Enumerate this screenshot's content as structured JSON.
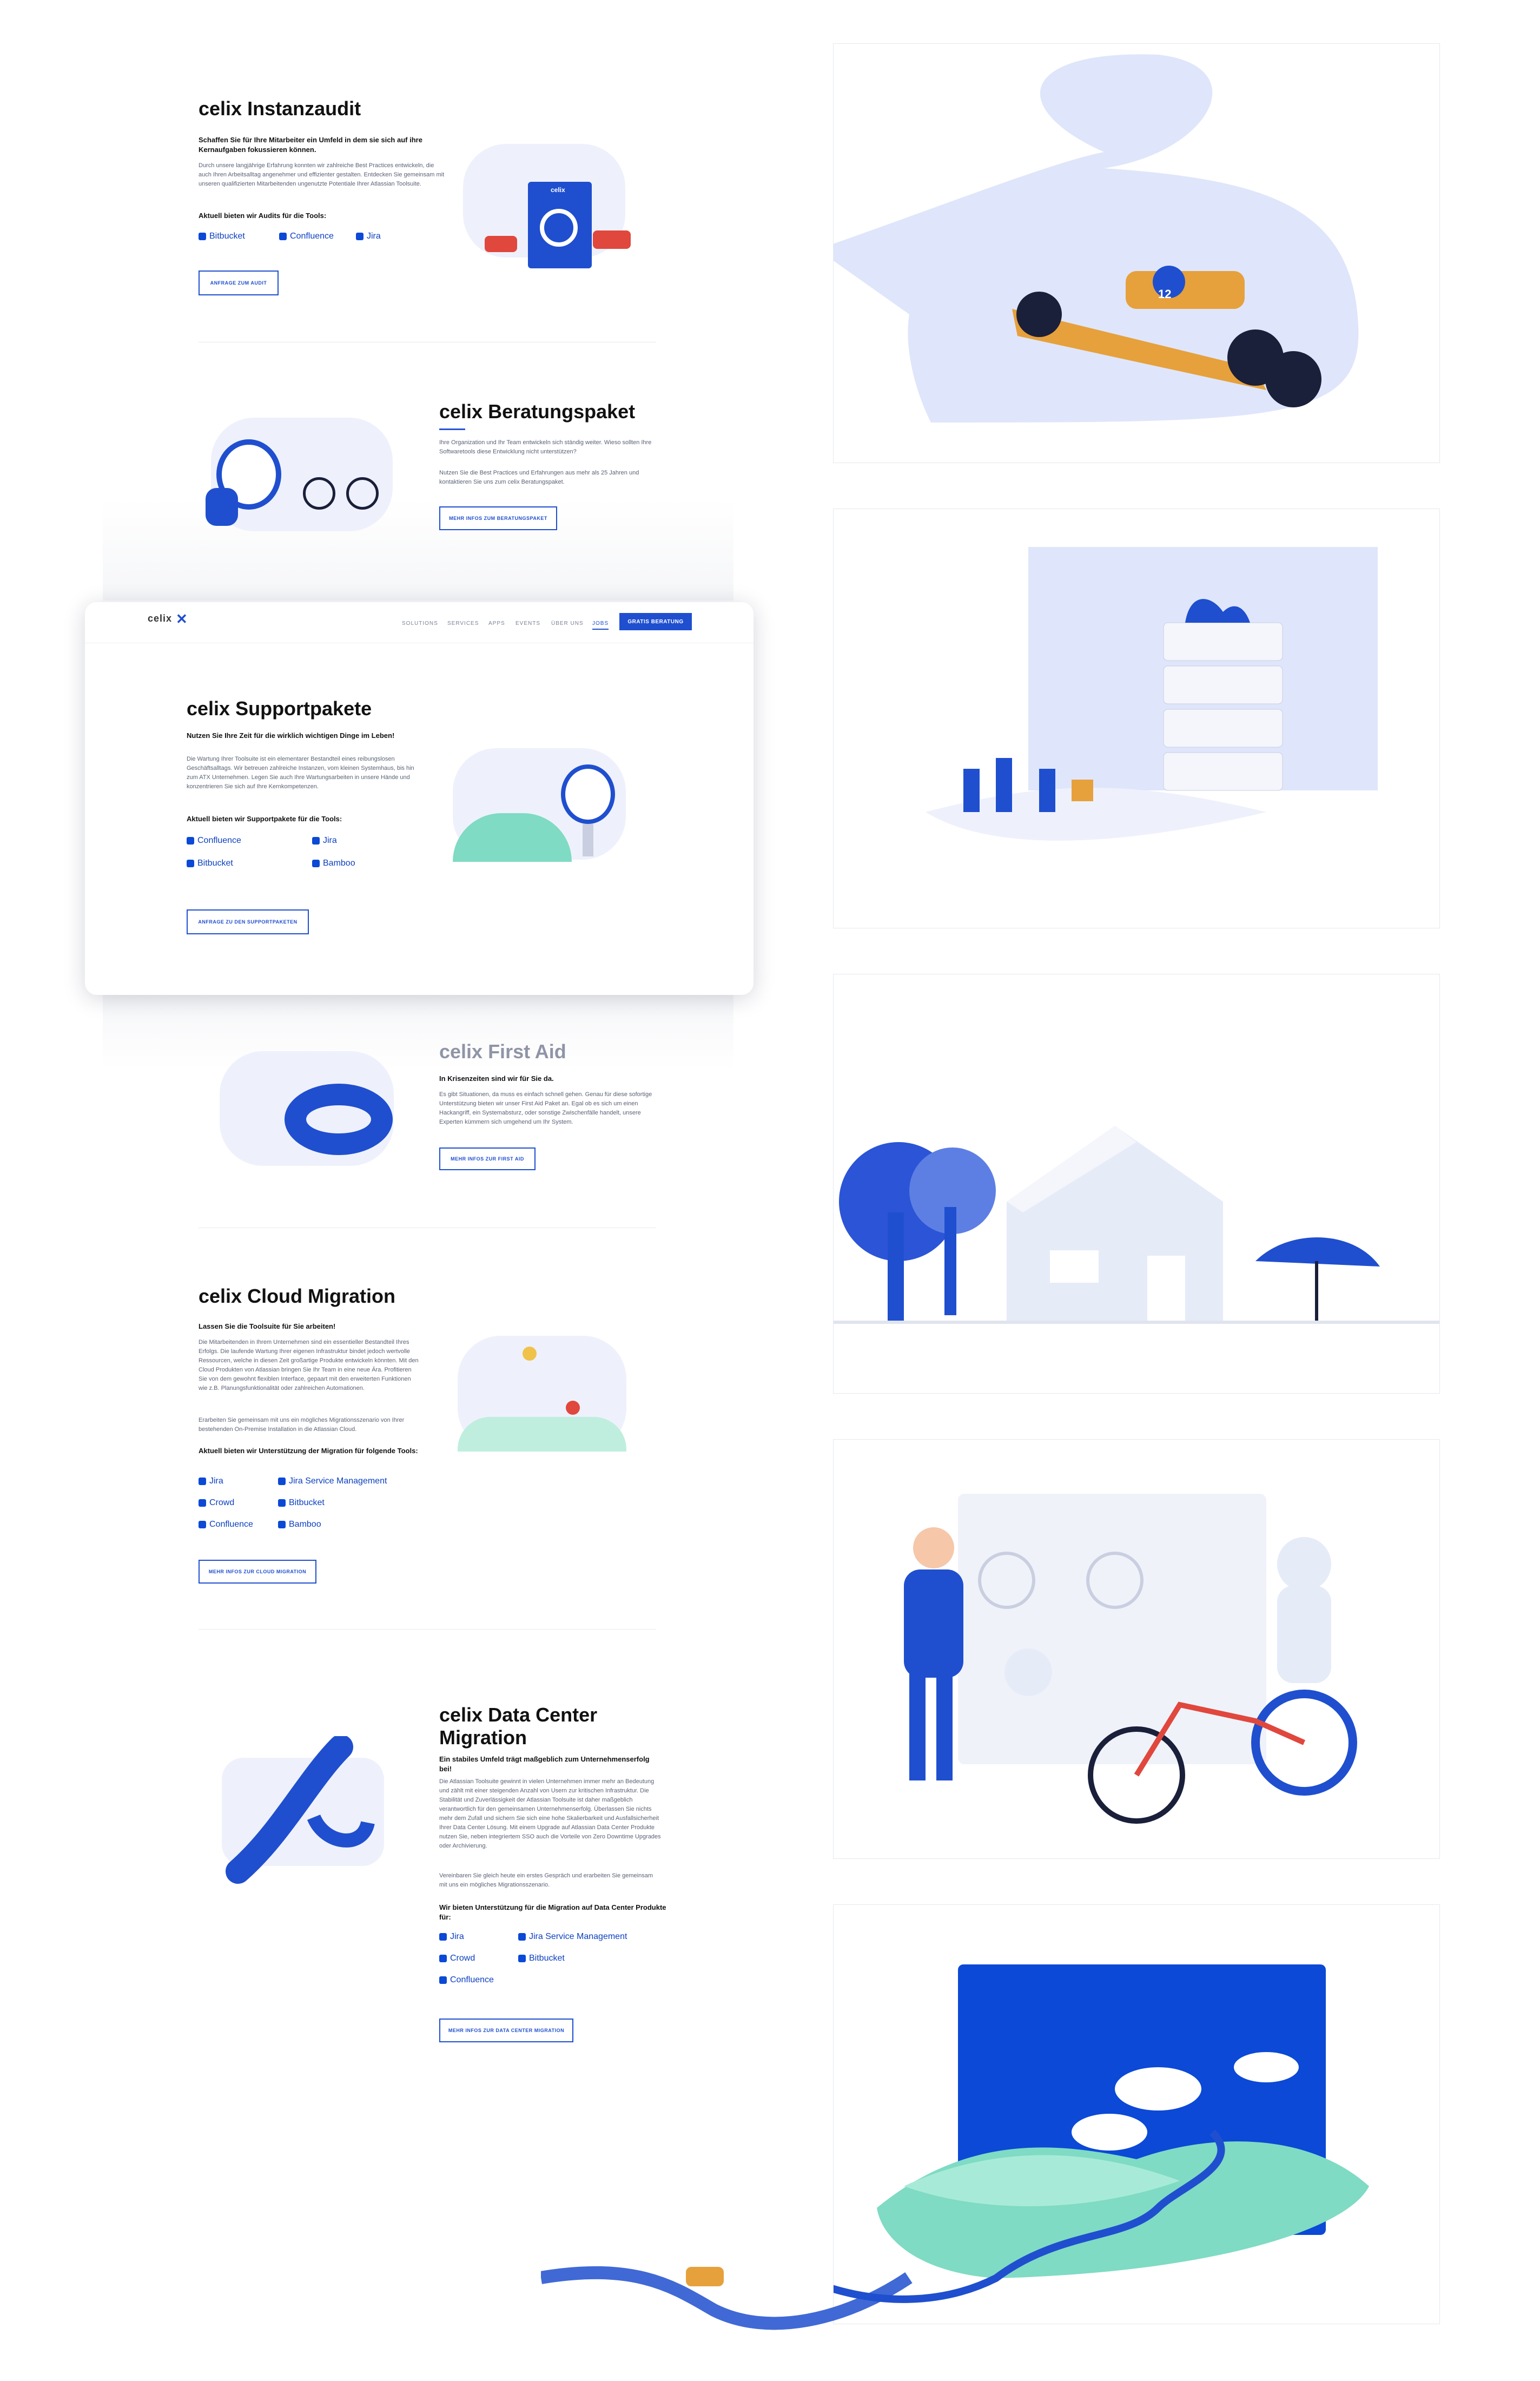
{
  "sections": {
    "instanzaudit": {
      "title": "celix Instanzaudit",
      "lead": "Schaffen Sie für Ihre Mitarbeiter ein Umfeld in dem sie sich auf ihre Kernaufgaben fokussieren können.",
      "body": "Durch unsere langjährige Erfahrung konnten wir zahlreiche Best Practices entwickeln, die auch Ihren Arbeitsalltag angenehmer und effizienter gestalten. Entdecken Sie gemeinsam mit unseren qualifizierten Mitarbeitenden ungenutzte Potentiale Ihrer Atlassian Toolsuite.",
      "tools_heading": "Aktuell bieten wir Audits für die Tools:",
      "tools": [
        "Bitbucket",
        "Confluence",
        "Jira"
      ],
      "cta": "ANFRAGE ZUM AUDIT"
    },
    "beratungspaket": {
      "title": "celix Beratungspaket",
      "body1": "Ihre Organization und Ihr Team entwickeln sich ständig weiter. Wieso sollten Ihre Softwaretools diese Entwicklung nicht unterstützen?",
      "body2": "Nutzen Sie die Best Practices und Erfahrungen aus mehr als 25 Jahren und kontaktieren Sie uns zum celix Beratungspaket.",
      "cta": "MEHR INFOS ZUM BERATUNGSPAKET"
    },
    "supportpakete": {
      "title": "celix Supportpakete",
      "lead": "Nutzen Sie Ihre Zeit für die wirklich wichtigen Dinge im Leben!",
      "body": "Die Wartung Ihrer Toolsuite ist ein elementarer Bestandteil eines reibungslosen Geschäftsalltags. Wir betreuen zahlreiche Instanzen, vom kleinen Systemhaus, bis hin zum ATX Unternehmen. Legen Sie auch Ihre Wartungsarbeiten in unsere Hände und konzentrieren Sie sich auf Ihre Kernkompetenzen.",
      "tools_heading": "Aktuell bieten wir Supportpakete für die Tools:",
      "tools": [
        "Confluence",
        "Jira",
        "Bitbucket",
        "Bamboo"
      ],
      "cta": "ANFRAGE ZU DEN SUPPORTPAKETEN"
    },
    "first_aid": {
      "title": "celix First Aid",
      "lead": "In Krisenzeiten sind wir für Sie da.",
      "body": "Es gibt Situationen, da muss es einfach schnell gehen. Genau für diese sofortige Unterstützung bieten wir unser First Aid Paket an. Egal ob es sich um einen Hackangriff, ein Systemabsturz, oder sonstige Zwischenfälle handelt, unsere Experten kümmern sich umgehend um Ihr System.",
      "cta": "MEHR INFOS ZUR FIRST AID"
    },
    "cloud_migration": {
      "title": "celix Cloud Migration",
      "lead": "Lassen Sie die Toolsuite für Sie arbeiten!",
      "body1": "Die Mitarbeitenden in Ihrem Unternehmen sind ein essentieller Bestandteil Ihres Erfolgs. Die laufende Wartung Ihrer eigenen Infrastruktur bindet jedoch wertvolle Ressourcen, welche in diesen Zeit großartige Produkte entwickeln könnten. Mit den Cloud Produkten von Atlassian bringen Sie Ihr Team in eine neue Ära. Profitieren Sie von dem gewohnt flexiblen Interface, gepaart mit den erweiterten Funktionen wie z.B. Planungsfunktionalität oder zahlreichen Automationen.",
      "body2": "Erarbeiten Sie gemeinsam mit uns ein mögliches Migrationsszenario von Ihrer bestehenden On-Premise Installation in die Atlassian Cloud.",
      "tools_heading": "Aktuell bieten wir Unterstützung der Migration für folgende Tools:",
      "tools": [
        "Jira",
        "Jira Service Management",
        "Crowd",
        "Bitbucket",
        "Confluence",
        "Bamboo"
      ],
      "cta": "MEHR INFOS ZUR CLOUD MIGRATION"
    },
    "data_center": {
      "title": "celix Data Center Migration",
      "lead": "Ein stabiles Umfeld trägt maßgeblich zum Unternehmenserfolg bei!",
      "body1": "Die Atlassian Toolsuite gewinnt in vielen Unternehmen immer mehr an Bedeutung und zählt mit einer steigenden Anzahl von Usern zur kritischen Infrastruktur. Die Stabilität und Zuverlässigkeit der Atlassian Toolsuite ist daher maßgeblich verantwortlich für den gemeinsamen Unternehmenserfolg. Überlassen Sie nichts mehr dem Zufall und sichern Sie sich eine hohe Skalierbarkeit und Ausfallsicherheit Ihrer Data Center Lösung. Mit einem Upgrade auf Atlassian Data Center Produkte nutzen Sie, neben integriertem SSO auch die Vorteile von Zero Downtime Upgrades oder Archivierung.",
      "body2": "Vereinbaren Sie gleich heute ein erstes Gespräch und erarbeiten Sie gemeinsam mit uns ein mögliches Migrationsszenario.",
      "tools_heading": "Wir bieten Unterstützung für die Migration auf Data Center Produkte für:",
      "tools": [
        "Jira",
        "Jira Service Management",
        "Crowd",
        "Bitbucket",
        "Confluence"
      ],
      "cta": "MEHR INFOS ZUR DATA CENTER MIGRATION"
    }
  },
  "nav": {
    "logo": "celix",
    "items": [
      "SOLUTIONS",
      "SERVICES",
      "APPS",
      "EVENTS",
      "ÜBER UNS",
      "JOBS"
    ],
    "cta": "GRATIS BERATUNG"
  },
  "illustrations": {
    "audit_badge": "celix",
    "race_car_number": "12"
  },
  "colors": {
    "accent": "#1f4fcf",
    "brand_blue": "#0b49d6",
    "light_blue": "#dfe6fb",
    "teal": "#7fdbc3"
  }
}
